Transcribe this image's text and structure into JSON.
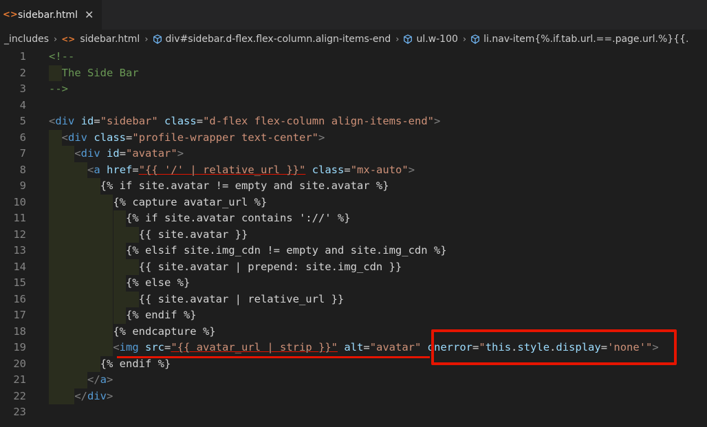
{
  "tab": {
    "title": "sidebar.html",
    "close": "✕",
    "icon": "<>"
  },
  "breadcrumbs": [
    {
      "label": "_includes",
      "icon": ""
    },
    {
      "label": "sidebar.html",
      "icon": "html"
    },
    {
      "label": "div#sidebar.d-flex.flex-column.align-items-end",
      "icon": "cube"
    },
    {
      "label": "ul.w-100",
      "icon": "cube"
    },
    {
      "label": "li.nav-item{%.if.tab.url.==.page.url.%}{{.",
      "icon": "cube"
    }
  ],
  "lines": [
    {
      "n": "1",
      "tokens": [
        [
          "tk-comment",
          "<!--"
        ]
      ]
    },
    {
      "n": "2",
      "tokens": [
        [
          "tk-comment",
          "  The Side Bar"
        ]
      ]
    },
    {
      "n": "3",
      "tokens": [
        [
          "tk-comment",
          "-->"
        ]
      ]
    },
    {
      "n": "4",
      "tokens": []
    },
    {
      "n": "5",
      "tokens": [
        [
          "tk-punct",
          "<"
        ],
        [
          "tk-tag",
          "div"
        ],
        [
          "tk-text",
          " "
        ],
        [
          "tk-attr",
          "id"
        ],
        [
          "tk-text",
          "="
        ],
        [
          "tk-str",
          "\"sidebar\""
        ],
        [
          "tk-text",
          " "
        ],
        [
          "tk-attr",
          "class"
        ],
        [
          "tk-text",
          "="
        ],
        [
          "tk-str",
          "\"d-flex flex-column align-items-end\""
        ],
        [
          "tk-punct",
          ">"
        ]
      ]
    },
    {
      "n": "6",
      "tokens": [
        [
          "tk-text",
          "  "
        ],
        [
          "tk-punct",
          "<"
        ],
        [
          "tk-tag",
          "div"
        ],
        [
          "tk-text",
          " "
        ],
        [
          "tk-attr",
          "class"
        ],
        [
          "tk-text",
          "="
        ],
        [
          "tk-str",
          "\"profile-wrapper text-center\""
        ],
        [
          "tk-punct",
          ">"
        ]
      ]
    },
    {
      "n": "7",
      "tokens": [
        [
          "tk-text",
          "    "
        ],
        [
          "tk-punct",
          "<"
        ],
        [
          "tk-tag",
          "div"
        ],
        [
          "tk-text",
          " "
        ],
        [
          "tk-attr",
          "id"
        ],
        [
          "tk-text",
          "="
        ],
        [
          "tk-str",
          "\"avatar\""
        ],
        [
          "tk-punct",
          ">"
        ]
      ]
    },
    {
      "n": "8",
      "tokens": [
        [
          "tk-text",
          "      "
        ],
        [
          "tk-punct",
          "<"
        ],
        [
          "tk-tag",
          "a"
        ],
        [
          "tk-text",
          " "
        ],
        [
          "tk-attr",
          "href"
        ],
        [
          "tk-text",
          "="
        ],
        [
          "tk-str",
          "\"{{ '/' | relative_url }}\""
        ],
        [
          "tk-text",
          " "
        ],
        [
          "tk-attr",
          "class"
        ],
        [
          "tk-text",
          "="
        ],
        [
          "tk-str",
          "\"mx-auto\""
        ],
        [
          "tk-punct",
          ">"
        ]
      ]
    },
    {
      "n": "9",
      "tokens": [
        [
          "tk-liquid",
          "        {% if site.avatar != empty and site.avatar %}"
        ]
      ]
    },
    {
      "n": "10",
      "tokens": [
        [
          "tk-liquid",
          "          {% capture avatar_url %}"
        ]
      ]
    },
    {
      "n": "11",
      "tokens": [
        [
          "tk-liquid",
          "            {% if site.avatar contains '://' %}"
        ]
      ]
    },
    {
      "n": "12",
      "tokens": [
        [
          "tk-liquid",
          "              {{ site.avatar }}"
        ]
      ]
    },
    {
      "n": "13",
      "tokens": [
        [
          "tk-liquid",
          "            {% elsif site.img_cdn != empty and site.img_cdn %}"
        ]
      ]
    },
    {
      "n": "14",
      "tokens": [
        [
          "tk-liquid",
          "              {{ site.avatar | prepend: site.img_cdn }}"
        ]
      ]
    },
    {
      "n": "15",
      "tokens": [
        [
          "tk-liquid",
          "            {% else %}"
        ]
      ]
    },
    {
      "n": "16",
      "tokens": [
        [
          "tk-liquid",
          "              {{ site.avatar | relative_url }}"
        ]
      ]
    },
    {
      "n": "17",
      "tokens": [
        [
          "tk-liquid",
          "            {% endif %}"
        ]
      ]
    },
    {
      "n": "18",
      "tokens": [
        [
          "tk-liquid",
          "          {% endcapture %}"
        ]
      ]
    },
    {
      "n": "19",
      "tokens": [
        [
          "tk-text",
          "          "
        ],
        [
          "tk-punct",
          "<"
        ],
        [
          "tk-tag",
          "img"
        ],
        [
          "tk-text",
          " "
        ],
        [
          "tk-attr",
          "src"
        ],
        [
          "tk-text",
          "="
        ],
        [
          "tk-str",
          "\"{{ avatar_url | strip }}\""
        ],
        [
          "tk-text",
          " "
        ],
        [
          "tk-attr",
          "alt"
        ],
        [
          "tk-text",
          "="
        ],
        [
          "tk-str",
          "\"avatar\""
        ],
        [
          "tk-text",
          " "
        ],
        [
          "tk-attr",
          "onerror"
        ],
        [
          "tk-text",
          "="
        ],
        [
          "tk-str",
          "\""
        ],
        [
          "tk-attr",
          "this"
        ],
        [
          "tk-text",
          "."
        ],
        [
          "tk-attr",
          "style"
        ],
        [
          "tk-text",
          "."
        ],
        [
          "tk-attr",
          "display"
        ],
        [
          "tk-text",
          "="
        ],
        [
          "tk-str",
          "'none'\""
        ],
        [
          "tk-punct",
          ">"
        ]
      ]
    },
    {
      "n": "20",
      "tokens": [
        [
          "tk-liquid",
          "        {% endif %}"
        ]
      ]
    },
    {
      "n": "21",
      "tokens": [
        [
          "tk-text",
          "      "
        ],
        [
          "tk-punct",
          "</"
        ],
        [
          "tk-tag",
          "a"
        ],
        [
          "tk-punct",
          ">"
        ]
      ]
    },
    {
      "n": "22",
      "tokens": [
        [
          "tk-text",
          "    "
        ],
        [
          "tk-punct",
          "</"
        ],
        [
          "tk-tag",
          "div"
        ],
        [
          "tk-punct",
          ">"
        ]
      ]
    },
    {
      "n": "23",
      "tokens": []
    }
  ],
  "colors": {
    "accent_red": "#e51400",
    "html_icon": "#e37933"
  }
}
